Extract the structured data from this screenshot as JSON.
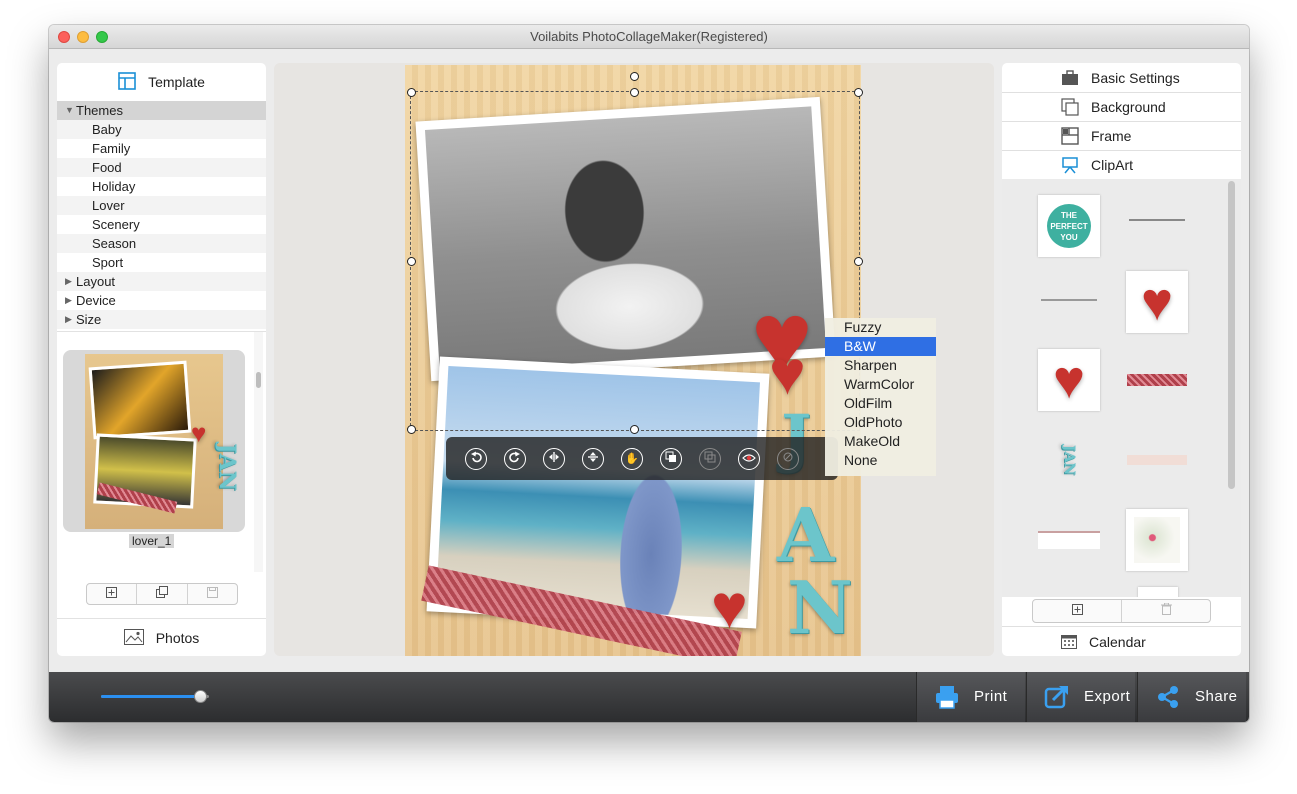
{
  "window": {
    "title": "Voilabits PhotoCollageMaker(Registered)"
  },
  "left_panel": {
    "template_tab": {
      "label": "Template",
      "icon": "template-icon"
    },
    "tree": [
      {
        "label": "Themes",
        "expanded": true,
        "children": [
          "Baby",
          "Family",
          "Food",
          "Holiday",
          "Lover",
          "Scenery",
          "Season",
          "Sport"
        ]
      },
      {
        "label": "Layout",
        "expanded": false
      },
      {
        "label": "Device",
        "expanded": false
      },
      {
        "label": "Size",
        "expanded": false
      }
    ],
    "selected_template": {
      "label": "lover_1"
    },
    "toolbar": {
      "add_icon": "add-icon",
      "duplicate_icon": "duplicate-icon",
      "save_icon": "save-icon"
    },
    "photos_tab": {
      "label": "Photos",
      "icon": "photos-icon"
    }
  },
  "canvas": {
    "jan_letters": [
      "J",
      "A",
      "N"
    ],
    "edit_toolbar": [
      {
        "name": "rotate-left-icon",
        "enabled": true
      },
      {
        "name": "rotate-right-icon",
        "enabled": true
      },
      {
        "name": "flip-horizontal-icon",
        "enabled": true
      },
      {
        "name": "flip-vertical-icon",
        "enabled": true
      },
      {
        "name": "hand-icon",
        "enabled": true
      },
      {
        "name": "bring-front-icon",
        "enabled": true
      },
      {
        "name": "send-back-icon",
        "enabled": false
      },
      {
        "name": "eye-icon",
        "enabled": true
      },
      {
        "name": "filter-icon",
        "enabled": false
      }
    ],
    "filter_menu": {
      "selected": "B&W",
      "items": [
        "Fuzzy",
        "B&W",
        "Sharpen",
        "WarmColor",
        "OldFilm",
        "OldPhoto",
        "MakeOld",
        "None"
      ]
    }
  },
  "right_panel": {
    "tabs": [
      {
        "label": "Basic Settings",
        "icon": "basic-settings-icon"
      },
      {
        "label": "Background",
        "icon": "background-icon"
      },
      {
        "label": "Frame",
        "icon": "frame-icon"
      },
      {
        "label": "ClipArt",
        "icon": "clipart-icon"
      }
    ],
    "clipart_badge_text": [
      "THE",
      "PERFECT",
      "YOU"
    ],
    "toolbar": {
      "add_icon": "add-icon",
      "delete_icon": "trash-icon"
    },
    "calendar_tab": {
      "label": "Calendar",
      "icon": "calendar-icon"
    }
  },
  "bottom_bar": {
    "zoom_level": 0.98,
    "buttons": [
      {
        "label": "Print",
        "icon": "print-icon"
      },
      {
        "label": "Export",
        "icon": "export-icon"
      },
      {
        "label": "Share",
        "icon": "share-icon"
      }
    ]
  },
  "colors": {
    "accent": "#2b8ff0",
    "menu_selected": "#2f6fe4",
    "heart": "#c7332e",
    "jan_letters": "#6cc5cb",
    "toolbar_bg": "#3a3b3e"
  }
}
